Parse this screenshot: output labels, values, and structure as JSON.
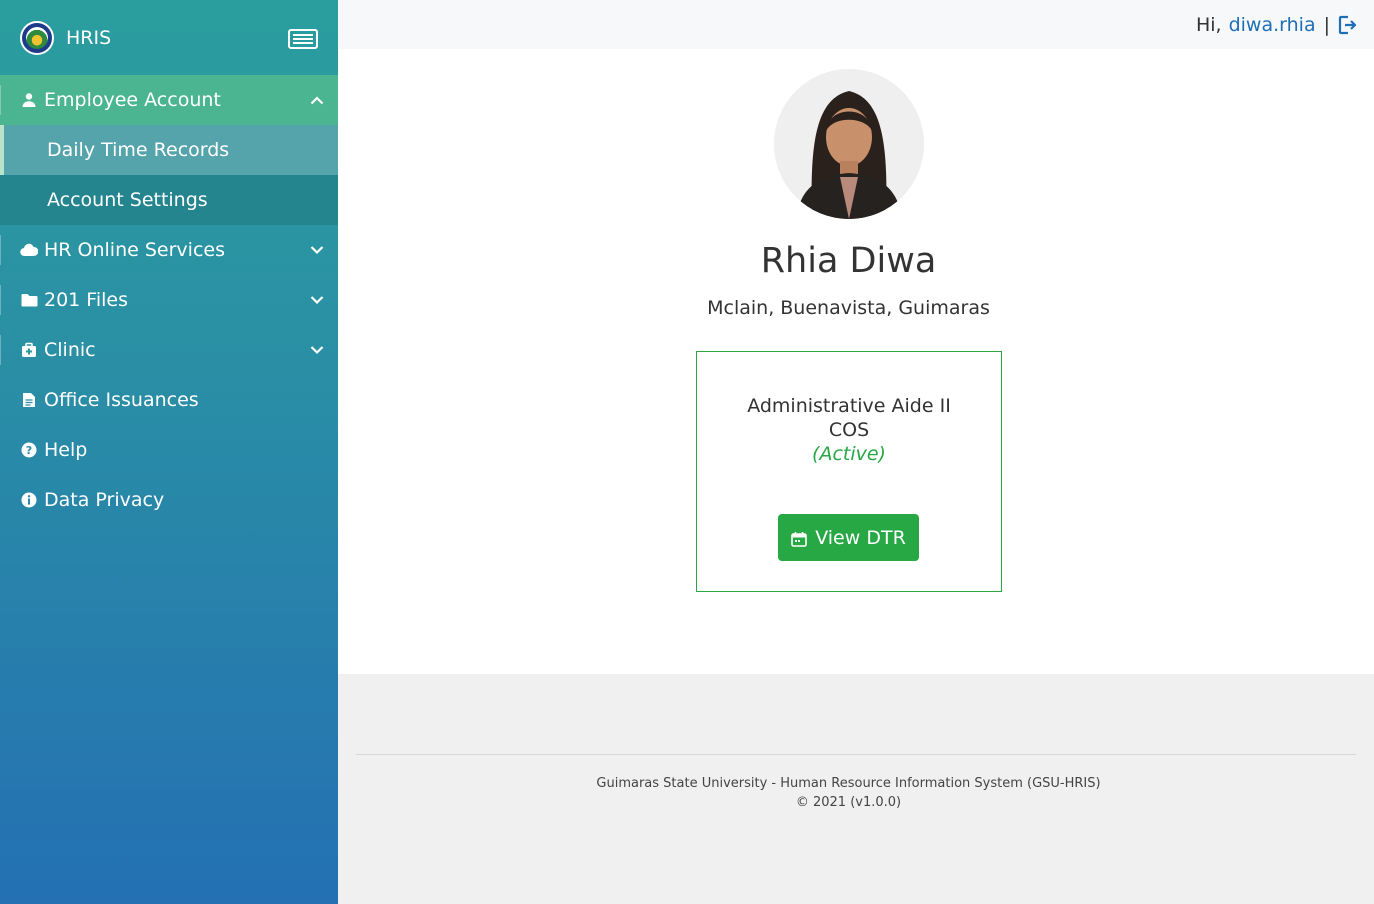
{
  "sidebar": {
    "brand": "HRIS",
    "items": [
      {
        "label": "Employee Account",
        "icon": "user-icon",
        "expanded": true
      },
      {
        "label": "Daily Time Records",
        "icon": "",
        "sub": true,
        "active": true
      },
      {
        "label": "Account Settings",
        "icon": "",
        "sub": true
      },
      {
        "label": "HR Online Services",
        "icon": "cloud-icon",
        "expanded": false
      },
      {
        "label": "201 Files",
        "icon": "folder-icon",
        "expanded": false
      },
      {
        "label": "Clinic",
        "icon": "medkit-icon",
        "expanded": false
      },
      {
        "label": "Office Issuances",
        "icon": "document-icon"
      },
      {
        "label": "Help",
        "icon": "question-circle-icon"
      },
      {
        "label": "Data Privacy",
        "icon": "info-circle-icon"
      }
    ]
  },
  "topbar": {
    "greeting": "Hi,",
    "username": "diwa.rhia",
    "separator": "|"
  },
  "profile": {
    "name": "Rhia Diwa",
    "address": "Mclain, Buenavista, Guimaras",
    "position": "Administrative Aide II",
    "employment_type": "COS",
    "status": "(Active)",
    "button_label": "View DTR"
  },
  "footer": {
    "line1": "Guimaras State University - Human Resource Information System (GSU-HRIS)",
    "line2": "© 2021 (v1.0.0)"
  },
  "colors": {
    "accent_green": "#28a745",
    "link_blue": "#1e6fb8",
    "sidebar_active": "#4bb592"
  }
}
